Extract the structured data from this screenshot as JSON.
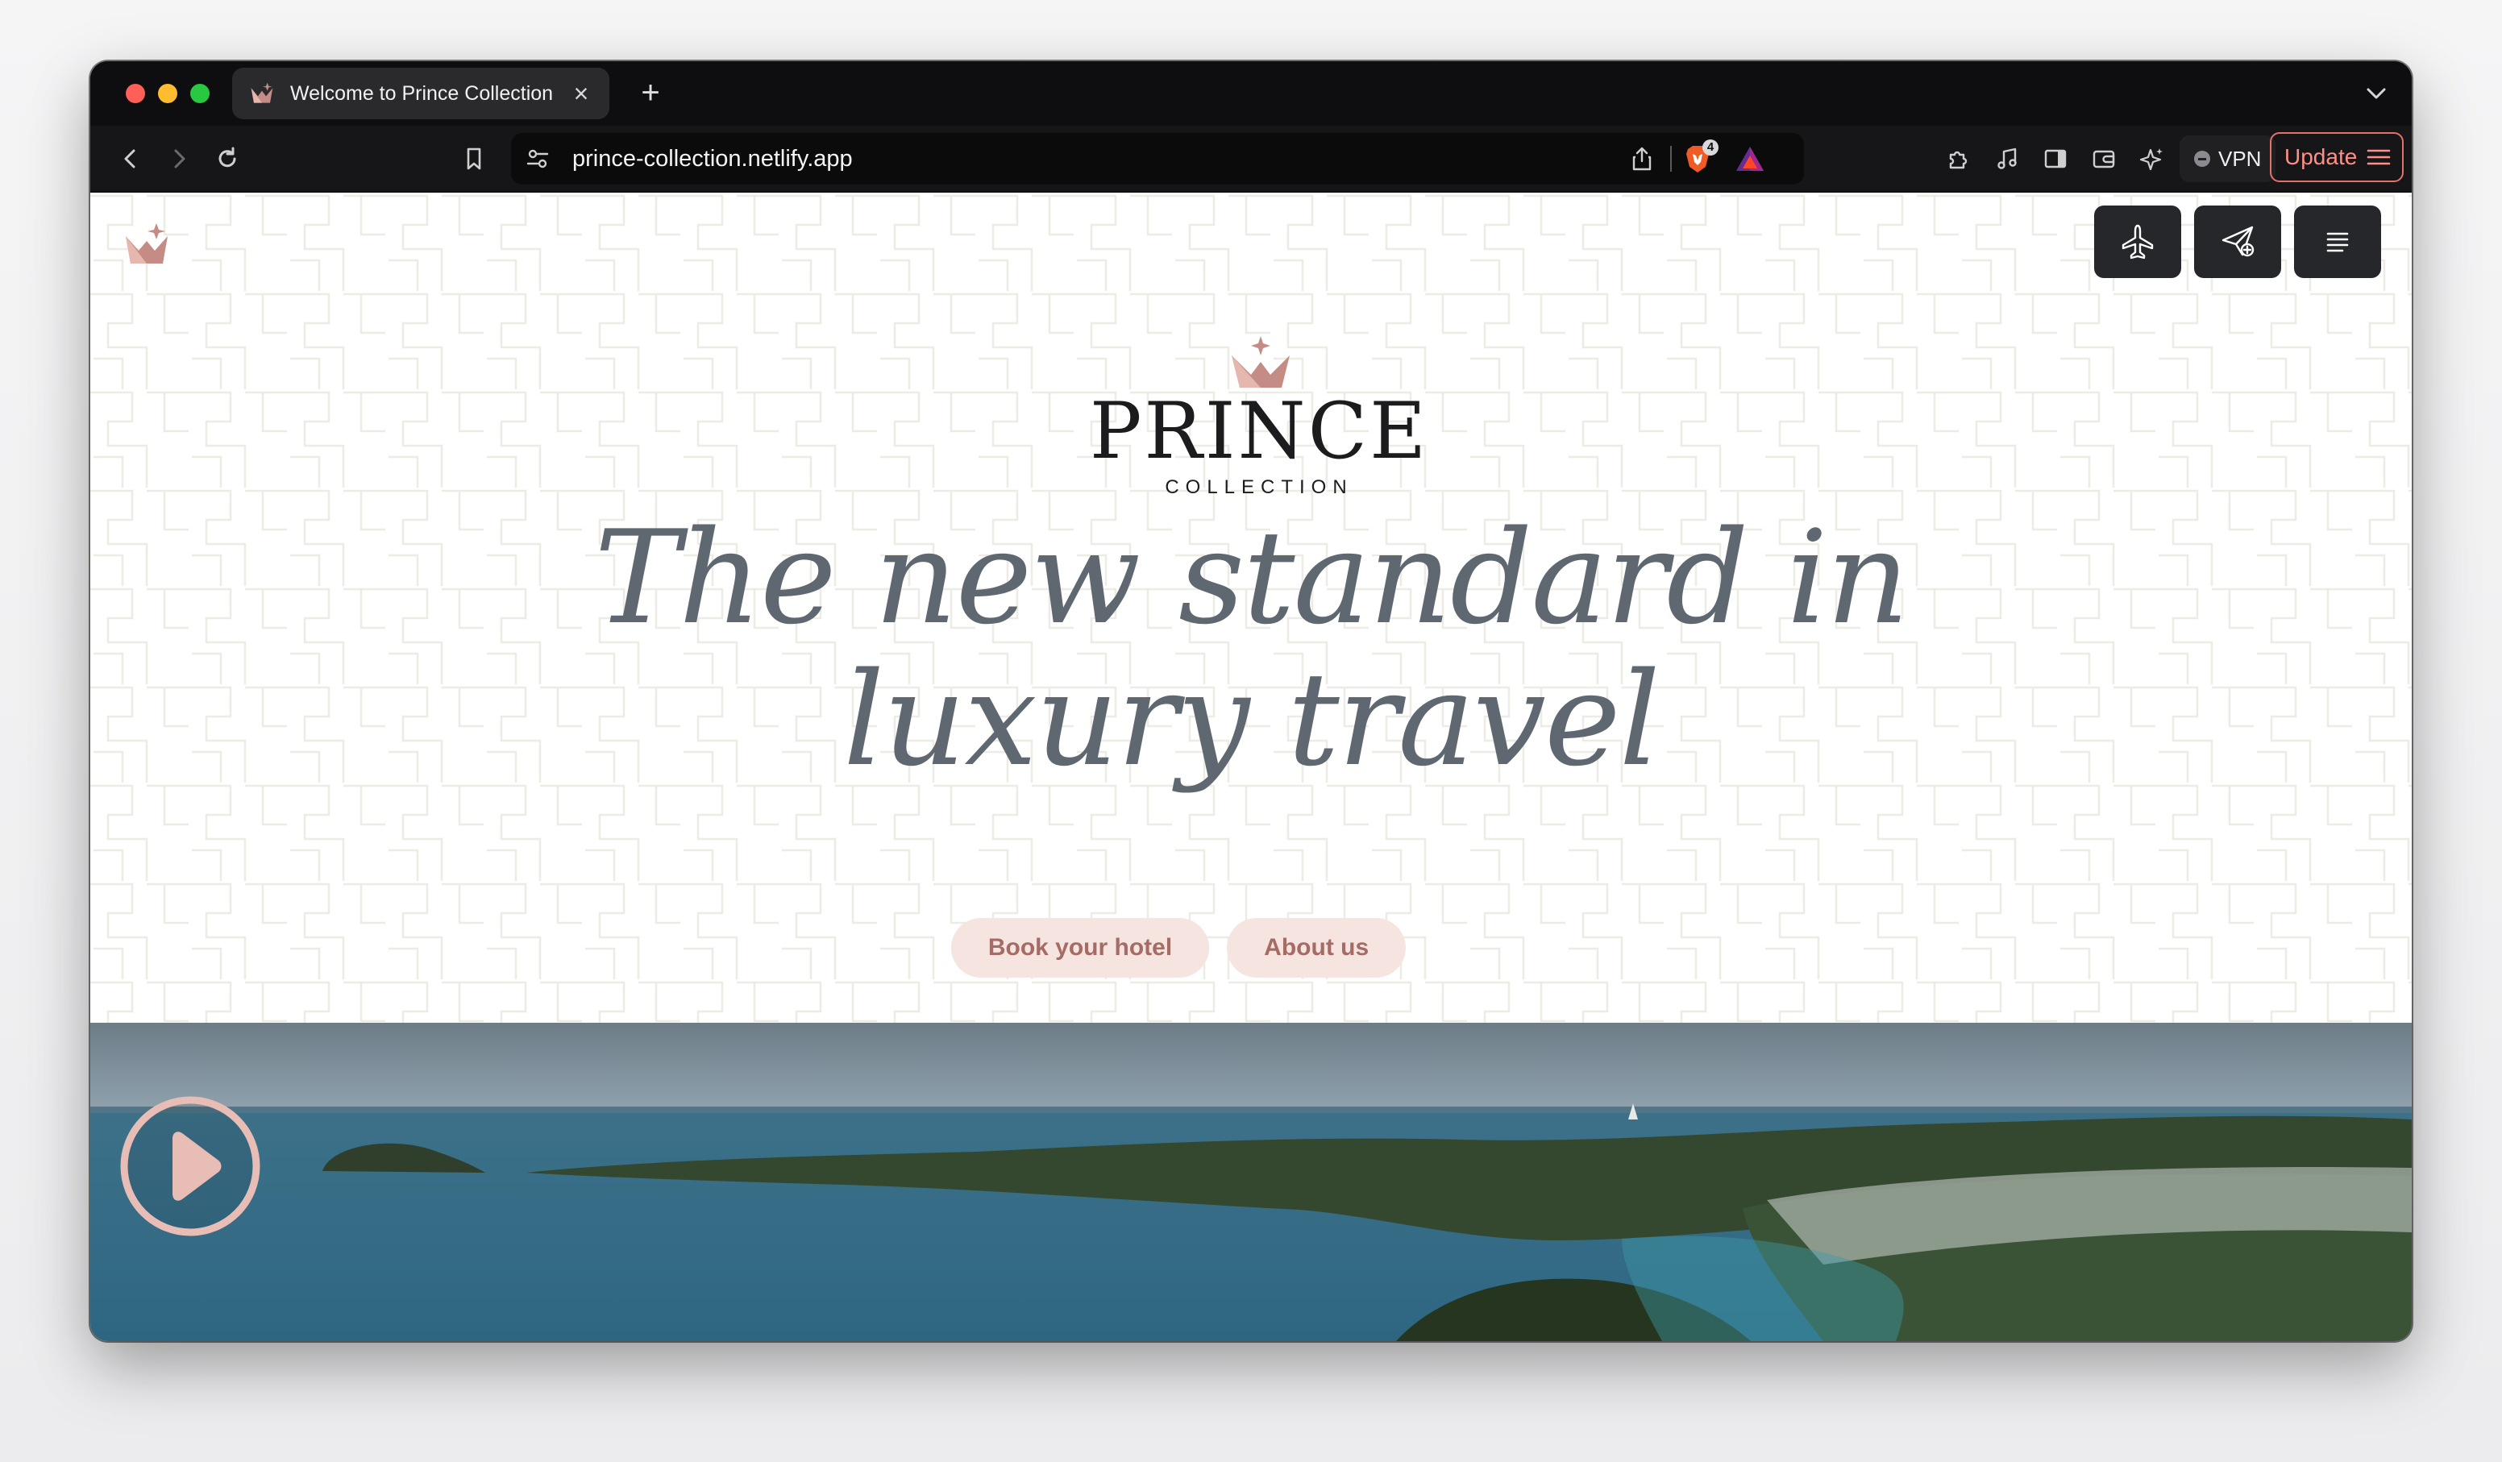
{
  "browser": {
    "tab": {
      "title": "Welcome to Prince Collection",
      "close_glyph": "×"
    },
    "new_tab_glyph": "+",
    "url": "prince-collection.netlify.app",
    "shield_count": "4",
    "vpn_label": "VPN",
    "update_label": "Update"
  },
  "site": {
    "brand_name": "PRINCE",
    "brand_sub": "COLLECTION",
    "headline_line1": "The new standard in",
    "headline_line2": "luxury travel",
    "cta_book": "Book your hotel",
    "cta_about": "About us",
    "colors": {
      "accent": "#c48c84",
      "cta_bg": "#f6e4e0",
      "cta_text": "#a56c65",
      "headline": "#5f6871",
      "nav_btn": "#25272b"
    }
  },
  "icons": {
    "favicon": "crown-logo-icon",
    "back": "chevron-left-icon",
    "forward": "chevron-right-icon",
    "reload": "reload-icon",
    "bookmark": "bookmark-icon",
    "site_settings": "sliders-icon",
    "share": "share-icon",
    "shields": "lion-shield-icon",
    "rewards": "triangle-rewards-icon",
    "extensions": "puzzle-icon",
    "media": "music-note-icon",
    "sidebar": "sidebar-icon",
    "wallet": "wallet-icon",
    "leo": "sparkle-icon",
    "nav_flights": "airplane-icon",
    "nav_send": "paper-plane-icon",
    "nav_menu": "menu-icon",
    "play": "play-icon"
  }
}
